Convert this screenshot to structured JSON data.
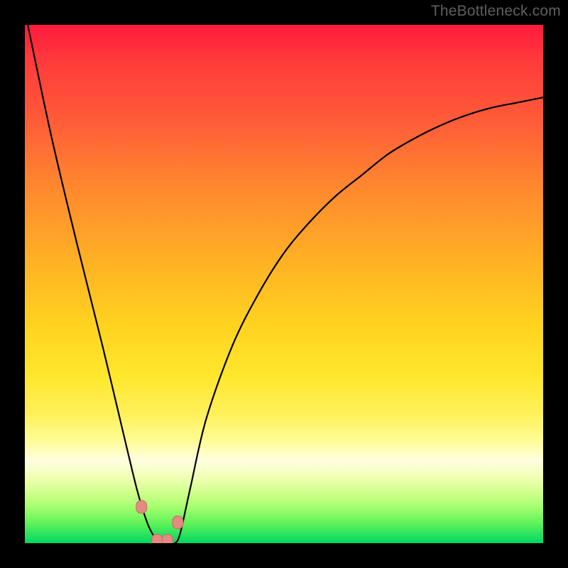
{
  "attribution": "TheBottleneck.com",
  "colors": {
    "background": "#000000",
    "gradient_top": "#ff1a3d",
    "gradient_bottom": "#00d861",
    "curve_stroke": "#000000",
    "marker_fill": "#e38b82",
    "marker_stroke": "#c66a5f"
  },
  "chart_data": {
    "type": "line",
    "title": "",
    "xlabel": "",
    "ylabel": "",
    "xlim": [
      0,
      100
    ],
    "ylim": [
      0,
      100
    ],
    "x": [
      0,
      5,
      10,
      15,
      20,
      22,
      24,
      26,
      27,
      28,
      29,
      30,
      32,
      35,
      40,
      45,
      50,
      55,
      60,
      65,
      70,
      75,
      80,
      85,
      90,
      95,
      100
    ],
    "values": [
      100,
      79,
      58,
      38,
      17,
      9,
      3,
      0,
      0,
      0,
      0,
      2,
      11,
      24,
      38,
      48,
      56,
      62,
      67,
      71,
      75,
      78,
      80.5,
      82.5,
      84,
      85,
      86
    ],
    "markers": [
      {
        "x": 22.5,
        "y": 7
      },
      {
        "x": 25.5,
        "y": 0.5
      },
      {
        "x": 27.5,
        "y": 0.5
      },
      {
        "x": 29.5,
        "y": 4
      }
    ],
    "curve_note": "V-shaped bottleneck curve; y≈0 near x≈26–28; left branch steep linear descent from top; right branch asymptotic rise toward ~86."
  }
}
